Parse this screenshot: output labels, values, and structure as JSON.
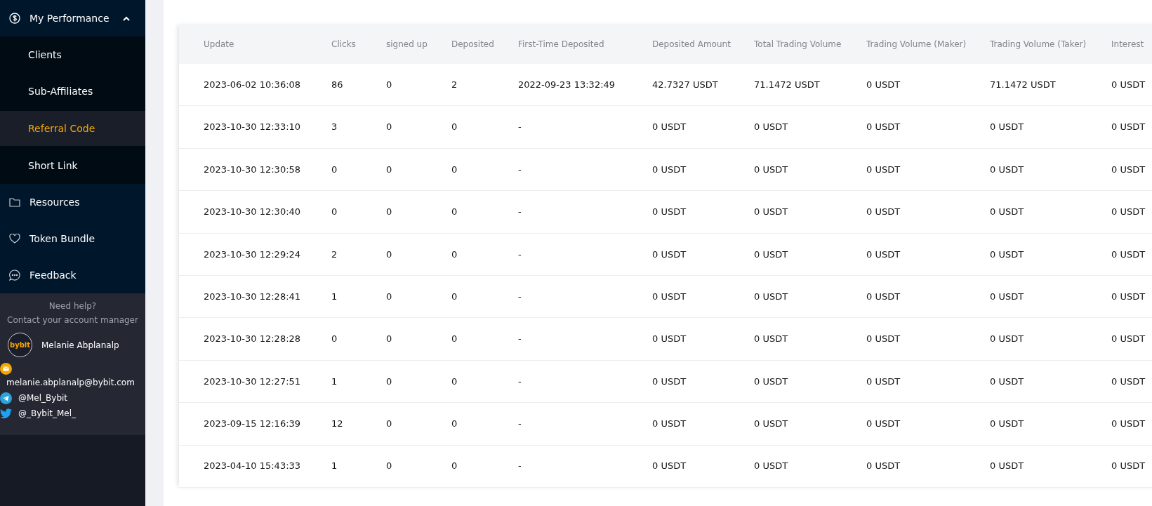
{
  "sidebar": {
    "items": [
      {
        "label": "My Performance",
        "kind": "dollar",
        "expanded": true,
        "children": [
          {
            "label": "Clients",
            "selected": false
          },
          {
            "label": "Sub-Affiliates",
            "selected": false
          },
          {
            "label": "Referral Code",
            "selected": true
          },
          {
            "label": "Short Link",
            "selected": false
          }
        ]
      },
      {
        "label": "Resources",
        "kind": "folder"
      },
      {
        "label": "Token Bundle",
        "kind": "heart"
      },
      {
        "label": "Feedback",
        "kind": "chat"
      }
    ]
  },
  "help": {
    "title": "Need help?",
    "subtitle": "Contact your account manager",
    "avatar_label": "bybit",
    "manager": "Melanie Abplanalp",
    "contacts": [
      {
        "kind": "email",
        "text": "melanie.abplanalp@bybit.com"
      },
      {
        "kind": "telegram",
        "text": "@Mel_Bybit"
      },
      {
        "kind": "twitter",
        "text": "@_Bybit_Mel_"
      }
    ]
  },
  "table": {
    "columns": [
      "Update",
      "Clicks",
      "signed up",
      "Deposited",
      "First-Time Deposited",
      "Deposited Amount",
      "Total Trading Volume",
      "Trading Volume (Maker)",
      "Trading Volume (Taker)",
      "Interest"
    ],
    "rows": [
      [
        "2023-06-02 10:36:08",
        "86",
        "0",
        "2",
        "2022-09-23 13:32:49",
        "42.7327 USDT",
        "71.1472 USDT",
        "0 USDT",
        "71.1472 USDT",
        "0 USDT"
      ],
      [
        "2023-10-30 12:33:10",
        "3",
        "0",
        "0",
        "-",
        "0 USDT",
        "0 USDT",
        "0 USDT",
        "0 USDT",
        "0 USDT"
      ],
      [
        "2023-10-30 12:30:58",
        "0",
        "0",
        "0",
        "-",
        "0 USDT",
        "0 USDT",
        "0 USDT",
        "0 USDT",
        "0 USDT"
      ],
      [
        "2023-10-30 12:30:40",
        "0",
        "0",
        "0",
        "-",
        "0 USDT",
        "0 USDT",
        "0 USDT",
        "0 USDT",
        "0 USDT"
      ],
      [
        "2023-10-30 12:29:24",
        "2",
        "0",
        "0",
        "-",
        "0 USDT",
        "0 USDT",
        "0 USDT",
        "0 USDT",
        "0 USDT"
      ],
      [
        "2023-10-30 12:28:41",
        "1",
        "0",
        "0",
        "-",
        "0 USDT",
        "0 USDT",
        "0 USDT",
        "0 USDT",
        "0 USDT"
      ],
      [
        "2023-10-30 12:28:28",
        "0",
        "0",
        "0",
        "-",
        "0 USDT",
        "0 USDT",
        "0 USDT",
        "0 USDT",
        "0 USDT"
      ],
      [
        "2023-10-30 12:27:51",
        "1",
        "0",
        "0",
        "-",
        "0 USDT",
        "0 USDT",
        "0 USDT",
        "0 USDT",
        "0 USDT"
      ],
      [
        "2023-09-15 12:16:39",
        "12",
        "0",
        "0",
        "-",
        "0 USDT",
        "0 USDT",
        "0 USDT",
        "0 USDT",
        "0 USDT"
      ],
      [
        "2023-04-10 15:43:33",
        "1",
        "0",
        "0",
        "-",
        "0 USDT",
        "0 USDT",
        "0 USDT",
        "0 USDT",
        "0 USDT"
      ]
    ]
  }
}
